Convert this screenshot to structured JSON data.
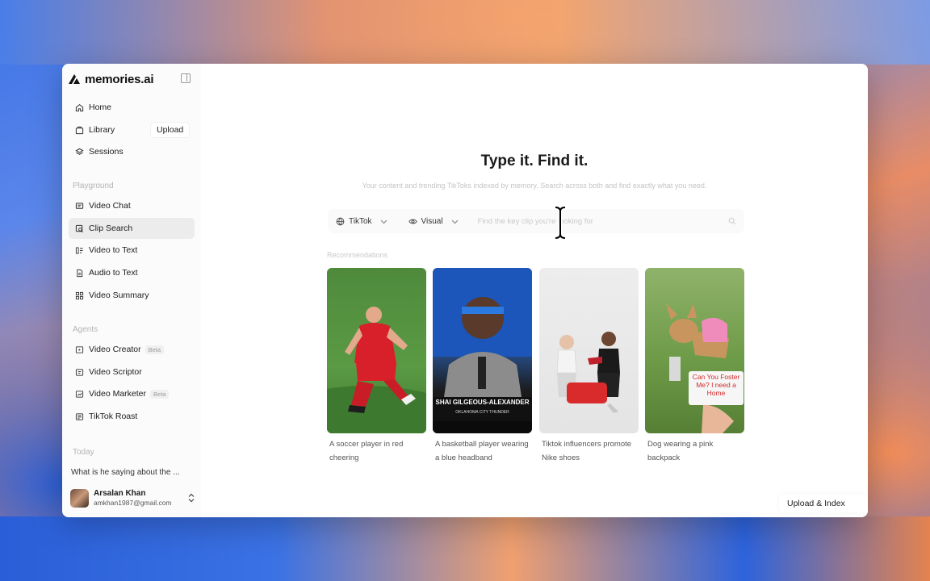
{
  "app": {
    "logo_text": "memories.ai"
  },
  "sidebar": {
    "main_nav": [
      {
        "label": "Home",
        "icon": "home-icon"
      },
      {
        "label": "Library",
        "icon": "library-icon"
      },
      {
        "label": "Sessions",
        "icon": "sessions-icon"
      }
    ],
    "upload_label": "Upload",
    "playground_label": "Playground",
    "playground_items": [
      {
        "label": "Video Chat",
        "icon": "chat-icon"
      },
      {
        "label": "Clip Search",
        "icon": "clip-search-icon",
        "active": true
      },
      {
        "label": "Video to Text",
        "icon": "video-text-icon"
      },
      {
        "label": "Audio to Text",
        "icon": "audio-text-icon"
      },
      {
        "label": "Video Summary",
        "icon": "summary-icon"
      }
    ],
    "agents_label": "Agents",
    "agent_items": [
      {
        "label": "Video Creator",
        "badge": "Beta"
      },
      {
        "label": "Video Scriptor",
        "badge": ""
      },
      {
        "label": "Video Marketer",
        "badge": "Beta"
      },
      {
        "label": "TikTok Roast",
        "badge": ""
      }
    ],
    "today_label": "Today",
    "recent_item": "What is he saying about the ...",
    "user": {
      "name": "Arsalan Khan",
      "email": "amkhan1987@gmail.com"
    }
  },
  "main": {
    "title": "Type it. Find it.",
    "subtitle": "Your content and trending TikToks indexed by memory. Search across both and find exactly what you need.",
    "search": {
      "source_filter": "TikTok",
      "mode_filter": "Visual",
      "placeholder": "Find the key clip you're looking for"
    },
    "recommendations_label": "Recommendations",
    "cards": [
      {
        "caption": "A soccer player in red cheering"
      },
      {
        "caption": "A basketball player wearing a blue headband"
      },
      {
        "caption": "Tiktok influencers promote Nike shoes"
      },
      {
        "caption": "Dog wearing a pink backpack"
      }
    ],
    "thumb_texts": {
      "basketball_name": "SHAI GILGEOUS-ALEXANDER",
      "basketball_team": "OKLAHOMA CITY THUNDER",
      "dog_sign": "Can You Foster Me? I need a Home"
    },
    "upload_index_label": "Upload & Index"
  }
}
